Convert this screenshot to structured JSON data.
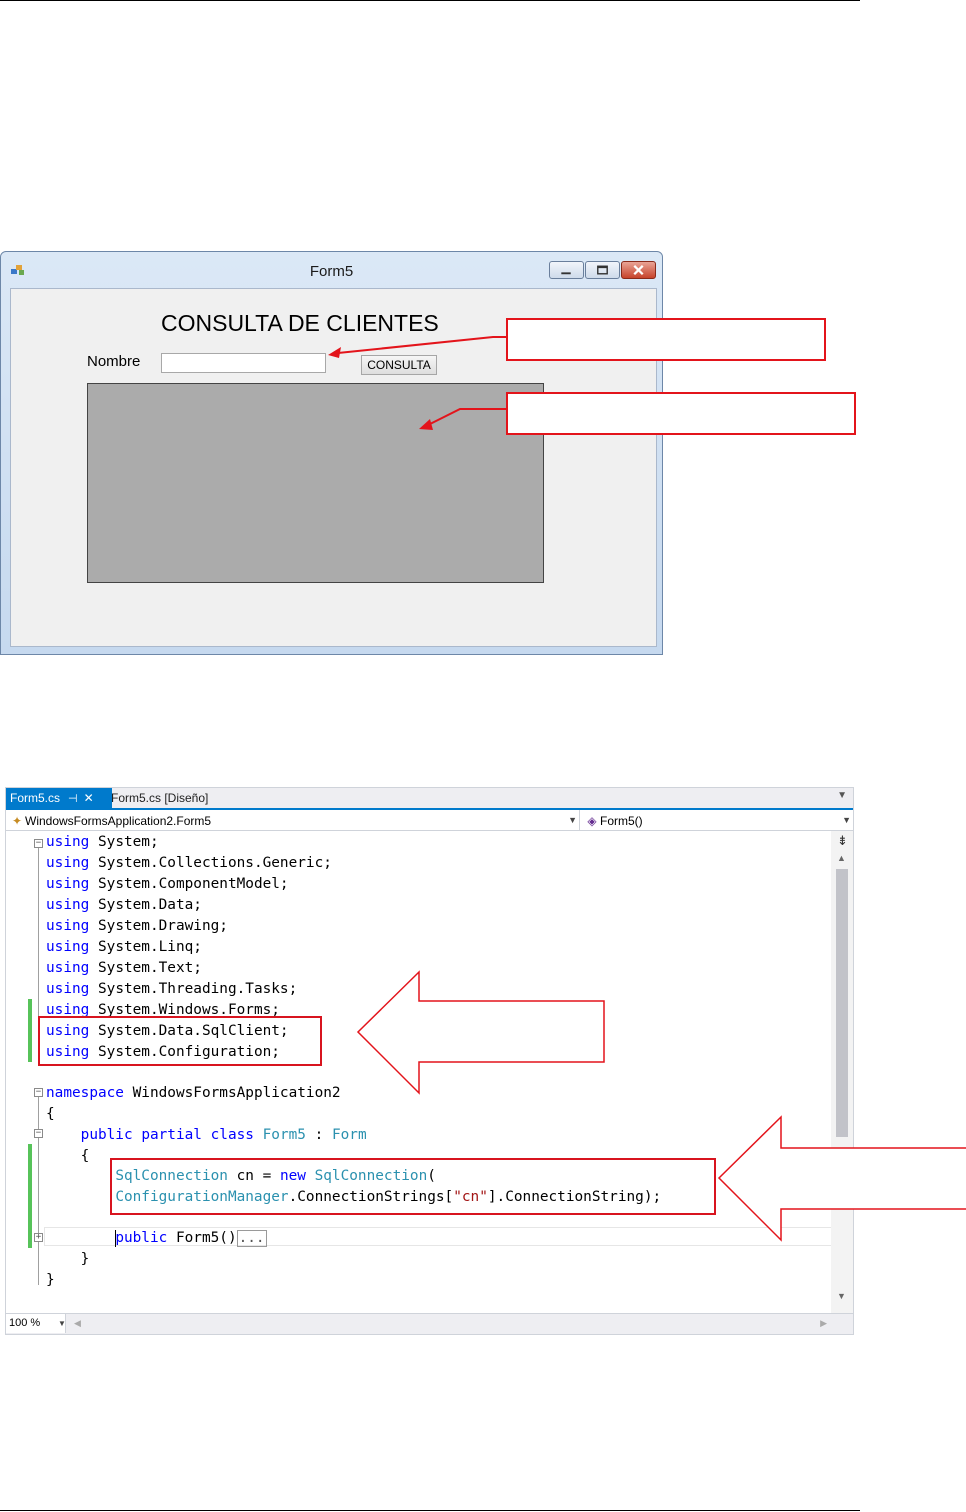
{
  "form_window": {
    "title": "Form5",
    "heading": "CONSULTA DE CLIENTES",
    "name_label": "Nombre",
    "name_value": "",
    "button_label": "CONSULTA"
  },
  "callouts": {
    "textbox_note": "",
    "grid_note": ""
  },
  "editor": {
    "tabs": [
      {
        "label": "Form5.cs",
        "active": true
      },
      {
        "label": "Form5.cs [Diseño]",
        "active": false
      }
    ],
    "nav_class": "WindowsFormsApplication2.Form5",
    "nav_member": "Form5()",
    "zoom": "100 %",
    "collapsed_marker": "...",
    "code_lines": [
      "using System;",
      "using System.Collections.Generic;",
      "using System.ComponentModel;",
      "using System.Data;",
      "using System.Drawing;",
      "using System.Linq;",
      "using System.Text;",
      "using System.Threading.Tasks;",
      "using System.Windows.Forms;",
      "using System.Data.SqlClient;",
      "using System.Configuration;",
      "",
      "namespace WindowsFormsApplication2",
      "{",
      "    public partial class Form5 : Form",
      "    {",
      "        SqlConnection cn = new SqlConnection(",
      "        ConfigurationManager.ConnectionStrings[\"cn\"].ConnectionString);",
      "",
      "        public Form5()",
      "    }",
      "}"
    ]
  }
}
